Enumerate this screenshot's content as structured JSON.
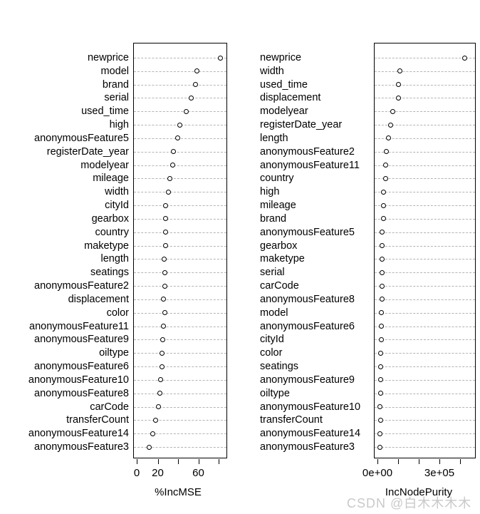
{
  "watermark": "CSDN @白木木木木",
  "chart_data": [
    {
      "type": "scatter",
      "panel": "left",
      "title": "",
      "xlabel": "%IncMSE",
      "ylabel": "",
      "xlim": [
        -6,
        88
      ],
      "xticks": [
        0,
        20,
        40,
        60,
        80
      ],
      "xticklabels": [
        "0",
        "20",
        "",
        "60",
        ""
      ],
      "grid": "horizontal-dotted",
      "legend": "none",
      "categories": [
        "newprice",
        "model",
        "brand",
        "serial",
        "used_time",
        "high",
        "anonymousFeature5",
        "registerDate_year",
        "modelyear",
        "mileage",
        "width",
        "cityId",
        "gearbox",
        "country",
        "maketype",
        "length",
        "seatings",
        "anonymousFeature2",
        "displacement",
        "color",
        "anonymousFeature11",
        "anonymousFeature9",
        "oiltype",
        "anonymousFeature6",
        "anonymousFeature10",
        "anonymousFeature8",
        "carCode",
        "transferCount",
        "anonymousFeature14",
        "anonymousFeature3"
      ],
      "values": [
        82.0,
        59.0,
        57.5,
        53.0,
        48.0,
        42.0,
        40.0,
        35.5,
        35.0,
        32.5,
        31.0,
        28.0,
        28.0,
        28.0,
        28.0,
        26.5,
        27.5,
        27.5,
        26.0,
        27.5,
        26.0,
        25.5,
        24.5,
        24.5,
        23.5,
        22.5,
        21.5,
        18.5,
        15.5,
        12.0
      ]
    },
    {
      "type": "scatter",
      "panel": "right",
      "title": "",
      "xlabel": "IncNodePurity",
      "ylabel": "",
      "xlim": [
        -18000,
        455000
      ],
      "xticks": [
        0,
        100000,
        200000,
        300000,
        400000
      ],
      "xticklabels": [
        "0e+00",
        "",
        "",
        "3e+05",
        ""
      ],
      "grid": "horizontal-dotted",
      "legend": "none",
      "categories": [
        "newprice",
        "width",
        "used_time",
        "displacement",
        "modelyear",
        "registerDate_year",
        "length",
        "anonymousFeature2",
        "anonymousFeature11",
        "country",
        "high",
        "mileage",
        "brand",
        "anonymousFeature5",
        "gearbox",
        "maketype",
        "serial",
        "carCode",
        "anonymousFeature8",
        "model",
        "anonymousFeature6",
        "cityId",
        "color",
        "seatings",
        "anonymousFeature9",
        "oiltype",
        "anonymousFeature10",
        "transferCount",
        "anonymousFeature14",
        "anonymousFeature3"
      ],
      "values": [
        424000,
        107000,
        101000,
        100000,
        75000,
        63000,
        54000,
        44000,
        41000,
        38000,
        30000,
        30000,
        30000,
        24000,
        24000,
        23000,
        22000,
        22000,
        21000,
        20000,
        19000,
        18000,
        17000,
        17000,
        16000,
        16000,
        12000,
        15000,
        11000,
        11000
      ]
    }
  ]
}
